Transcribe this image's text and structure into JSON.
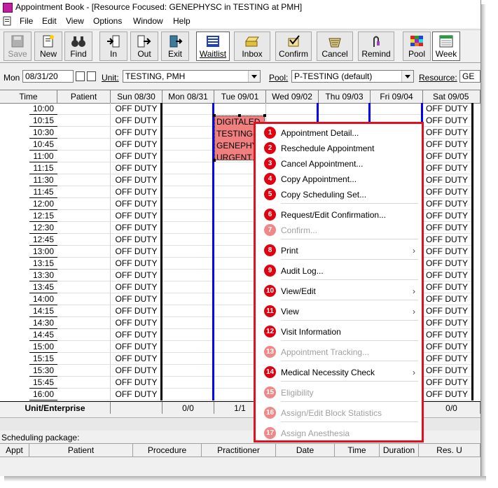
{
  "window": {
    "title": "Appointment Book - [Resource Focused:  GENEPHYSC in TESTING at PMH]"
  },
  "menu": [
    "File",
    "Edit",
    "View",
    "Options",
    "Window",
    "Help"
  ],
  "toolbar": [
    {
      "label": "Save",
      "icon": "save-icon",
      "disabled": true
    },
    {
      "label": "New",
      "icon": "new-document-icon"
    },
    {
      "label": "Find",
      "icon": "binoculars-icon"
    },
    {
      "label": "In",
      "icon": "check-in-icon"
    },
    {
      "label": "Out",
      "icon": "check-out-icon"
    },
    {
      "label": "Exit",
      "icon": "exit-door-icon"
    },
    {
      "label": "Waitlist",
      "icon": "waitlist-icon",
      "pressed": true
    },
    {
      "label": "Inbox",
      "icon": "inbox-tray-icon"
    },
    {
      "label": "Confirm",
      "icon": "confirm-check-icon"
    },
    {
      "label": "Cancel",
      "icon": "cancel-basket-icon"
    },
    {
      "label": "Remind",
      "icon": "remind-string-icon"
    },
    {
      "label": "Pool",
      "icon": "pool-grid-icon"
    },
    {
      "label": "Week",
      "icon": "week-calendar-icon",
      "pressed": true
    }
  ],
  "filters": {
    "day_label": "Mon",
    "date_value": "08/31/20",
    "unit_label": "Unit:",
    "unit_value": "TESTING, PMH",
    "pool_label": "Pool:",
    "pool_value": "P-TESTING (default)",
    "resource_label": "Resource:",
    "resource_value": "GE"
  },
  "grid": {
    "headers": [
      "Time",
      "Patient",
      "Sun 08/30",
      "Mon 08/31",
      "Tue 09/01",
      "Wed 09/02",
      "Thu 09/03",
      "Fri 09/04",
      "Sat 09/05"
    ],
    "times": [
      "10:00",
      "10:15",
      "10:30",
      "10:45",
      "11:00",
      "11:15",
      "11:30",
      "11:45",
      "12:00",
      "12:15",
      "12:30",
      "12:45",
      "13:00",
      "13:15",
      "13:30",
      "13:45",
      "14:00",
      "14:15",
      "14:30",
      "14:45",
      "15:00",
      "15:15",
      "15:30",
      "15:45",
      "16:00"
    ],
    "off_duty": "OFF DUTY",
    "appointment_lines": [
      "DIGITALED",
      "TESTING-",
      "GENEPHY",
      "URGENT"
    ],
    "footer": {
      "label": "Unit/Enterprise",
      "mon": "0/0",
      "tue": "1/1",
      "sat": "0/0"
    }
  },
  "colors": {
    "appointment": "#f08080",
    "separator_blue": "#0000ff",
    "highlight_red": "#e01020"
  },
  "package": {
    "label": "Scheduling package:",
    "columns": [
      "Appt",
      "Patient",
      "Procedure",
      "Practitioner",
      "Date",
      "Time",
      "Duration",
      "Res. U"
    ]
  },
  "context_menu": [
    {
      "n": "1",
      "label": "Appointment Detail...",
      "enabled": true
    },
    {
      "n": "2",
      "label": "Reschedule Appointment",
      "enabled": true
    },
    {
      "n": "3",
      "label": "Cancel Appointment...",
      "enabled": true
    },
    {
      "n": "4",
      "label": "Copy Appointment...",
      "enabled": true
    },
    {
      "n": "5",
      "label": "Copy Scheduling Set...",
      "enabled": true
    },
    {
      "n": "6",
      "label": "Request/Edit Confirmation...",
      "enabled": true
    },
    {
      "n": "7",
      "label": "Confirm...",
      "enabled": false
    },
    {
      "n": "8",
      "label": "Print",
      "enabled": true,
      "submenu": true
    },
    {
      "n": "9",
      "label": "Audit Log...",
      "enabled": true
    },
    {
      "n": "10",
      "label": "View/Edit",
      "enabled": true,
      "submenu": true
    },
    {
      "n": "11",
      "label": "View",
      "enabled": true,
      "submenu": true
    },
    {
      "n": "12",
      "label": "Visit Information",
      "enabled": true
    },
    {
      "n": "13",
      "label": "Appointment Tracking...",
      "enabled": false
    },
    {
      "n": "14",
      "label": "Medical Necessity Check",
      "enabled": true,
      "submenu": true
    },
    {
      "n": "15",
      "label": "Eligibility",
      "enabled": false
    },
    {
      "n": "16",
      "label": "Assign/Edit Block Statistics",
      "enabled": false
    },
    {
      "n": "17",
      "label": "Assign Anesthesia",
      "enabled": false
    }
  ]
}
